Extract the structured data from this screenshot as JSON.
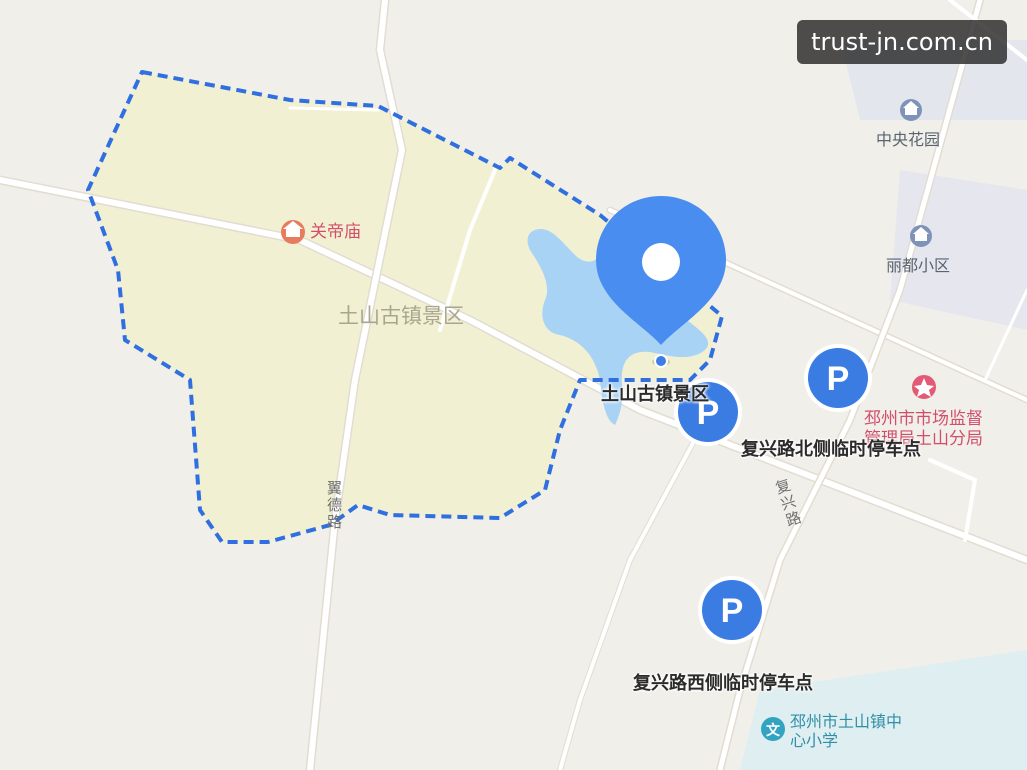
{
  "watermark": "trust-jn.com.cn",
  "area": {
    "name": "土山古镇景区",
    "pin_label": "土山古镇景区"
  },
  "pois": {
    "guandi_temple": "关帝庙",
    "zhongyang_garden": "中央花园",
    "lidu_community": "丽都小区",
    "market_bureau": "邳州市市场监督管理局土山分局",
    "school": "邳州市土山镇中心小学"
  },
  "roads": {
    "yide": "翼德路",
    "fuxing": "复兴路"
  },
  "parking": {
    "north_label": "复兴路北侧临时停车点",
    "west_label": "复兴路西侧临时停车点",
    "symbol": "P"
  },
  "colors": {
    "background": "#f1efe9",
    "scenic_fill": "#f2f0d2",
    "boundary": "#2f6fe0",
    "water": "#a9d3f5",
    "parking": "#3b7ce3",
    "pin": "#4a8df0",
    "accent_red": "#e35a74"
  }
}
